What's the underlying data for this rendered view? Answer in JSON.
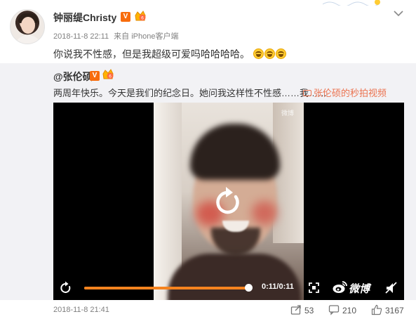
{
  "post": {
    "author": "钟丽缇Christy",
    "verified_badge": "V",
    "time": "2018-11-8 22:11",
    "source": "来自 iPhone客户端",
    "text": "你说我不性感，但是我超级可爱吗哈哈哈哈。",
    "emojis": [
      "laugh-emoji",
      "laugh-emoji",
      "laugh-emoji"
    ]
  },
  "repost": {
    "author": "@张伦硕",
    "verified_badge": "V",
    "text": "两周年快乐。今天是我们的纪念日。她问我这样性不性感……我……",
    "video_link": "张伦硕的秒拍视频"
  },
  "video": {
    "time": "0:11/0:11",
    "progress": 1.0,
    "logo_text": "微博",
    "watermark": "微博"
  },
  "footer": {
    "time": "2018-11-8 21:41",
    "reposts": "53",
    "comments": "210",
    "likes": "3167"
  },
  "colors": {
    "accent": "#f5831f",
    "link": "#eb7350",
    "verified": "#f86c0c",
    "repost_bg": "#f2f2f5"
  }
}
